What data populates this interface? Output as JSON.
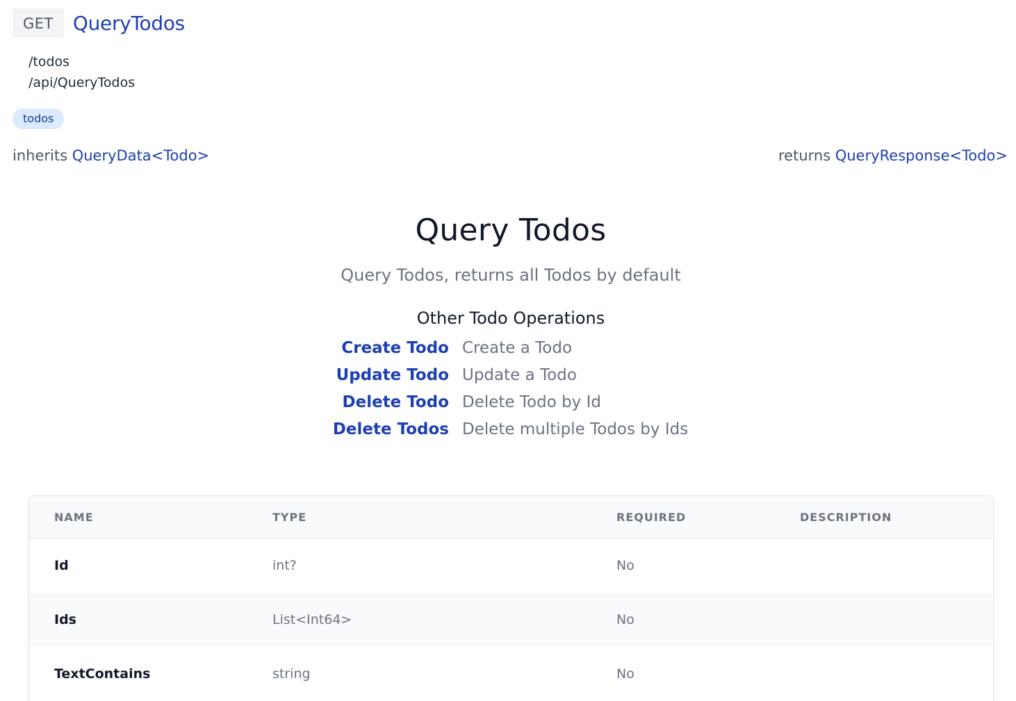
{
  "operation": {
    "method": "GET",
    "name": "QueryTodos",
    "routes": [
      "/todos",
      "/api/QueryTodos"
    ],
    "tag": "todos",
    "inherits_label": "inherits",
    "inherits_type": "QueryData<Todo>",
    "returns_label": "returns",
    "returns_type": "QueryResponse<Todo>"
  },
  "doc": {
    "title": "Query Todos",
    "subtitle": "Query Todos, returns all Todos by default",
    "other_ops_heading": "Other Todo Operations",
    "other_ops": [
      {
        "label": "Create Todo",
        "description": "Create a Todo"
      },
      {
        "label": "Update Todo",
        "description": "Update a Todo"
      },
      {
        "label": "Delete Todo",
        "description": "Delete Todo by Id"
      },
      {
        "label": "Delete Todos",
        "description": "Delete multiple Todos by Ids"
      }
    ]
  },
  "table": {
    "headers": [
      "NAME",
      "TYPE",
      "REQUIRED",
      "DESCRIPTION"
    ],
    "rows": [
      {
        "name": "Id",
        "type": "int?",
        "required": "No",
        "description": ""
      },
      {
        "name": "Ids",
        "type": "List<Int64>",
        "required": "No",
        "description": ""
      },
      {
        "name": "TextContains",
        "type": "string",
        "required": "No",
        "description": ""
      }
    ]
  }
}
